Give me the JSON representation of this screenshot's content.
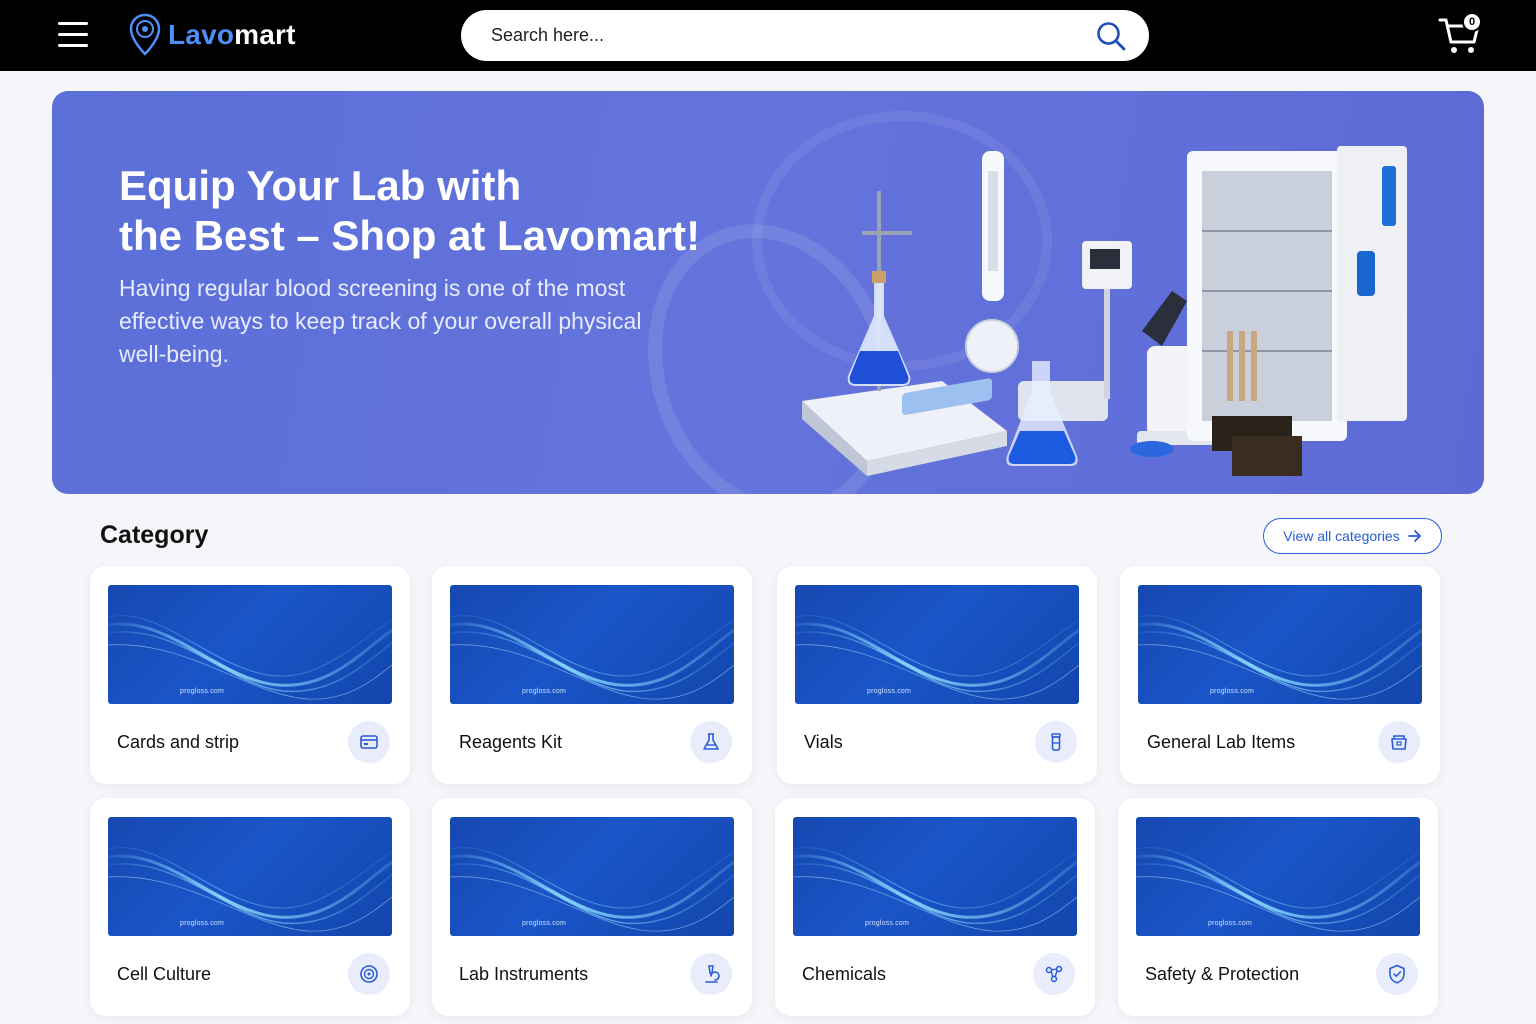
{
  "header": {
    "logo": {
      "part1": "Lavo",
      "part2": "mart"
    },
    "search": {
      "placeholder": "Search here..."
    },
    "cart": {
      "count": "0"
    }
  },
  "hero": {
    "title_line1": "Equip Your Lab with",
    "title_line2": "the Best – Shop at Lavomart!",
    "subtitle": "Having regular blood screening is one of the most effective ways to keep track of your overall physical well-being."
  },
  "category": {
    "title": "Category",
    "view_all": "View all categories",
    "items": [
      {
        "label": "Cards and strip",
        "icon": "card-icon",
        "watermark": "progloss.com"
      },
      {
        "label": "Reagents Kit",
        "icon": "flask-icon",
        "watermark": "progloss.com"
      },
      {
        "label": "Vials",
        "icon": "vial-icon",
        "watermark": "progloss.com"
      },
      {
        "label": "General Lab Items",
        "icon": "lab-box-icon",
        "watermark": "progloss.com"
      },
      {
        "label": "Cell Culture",
        "icon": "cell-icon",
        "watermark": "progloss.com"
      },
      {
        "label": "Lab Instruments",
        "icon": "microscope-icon",
        "watermark": "progloss.com"
      },
      {
        "label": "Chemicals",
        "icon": "molecule-icon",
        "watermark": "progloss.com"
      },
      {
        "label": "Safety & Protection",
        "icon": "shield-icon",
        "watermark": "progloss.com"
      }
    ]
  },
  "colors": {
    "brand_blue": "#4f8ef7",
    "accent": "#2a5bd7",
    "hero_bg": "#6070db",
    "header_bg": "#000000"
  }
}
